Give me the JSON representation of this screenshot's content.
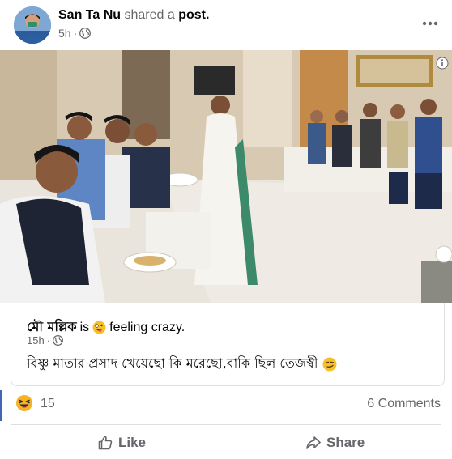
{
  "header": {
    "author": "San Ta Nu",
    "verb": "shared a",
    "object": "post.",
    "time": "5h",
    "dot": "·"
  },
  "shared": {
    "name": "মৌ মল্লিক",
    "is": "is",
    "feeling": "feeling crazy.",
    "time": "15h",
    "dot": "·",
    "text": "বিষ্ণু মাতার প্রসাদ খেয়েছো কি মরেছো,বাকি ছিল তেজস্বী"
  },
  "reactions": {
    "count": "15",
    "comments": "6 Comments"
  },
  "actions": {
    "like": "Like",
    "share": "Share"
  },
  "colors": {
    "accent": "#4267b2",
    "secondary_text": "#65676b",
    "reaction_yellow": "#f7b125"
  },
  "icons": {
    "avatar": "user-avatar",
    "globe": "globe-icon",
    "more": "more-dots-icon",
    "info": "info-icon",
    "feeling": "crazy-face-emoji",
    "smirk": "smirk-emoji",
    "reaction": "haha-reaction-icon",
    "like": "thumbs-up-icon",
    "share": "share-arrow-icon"
  }
}
